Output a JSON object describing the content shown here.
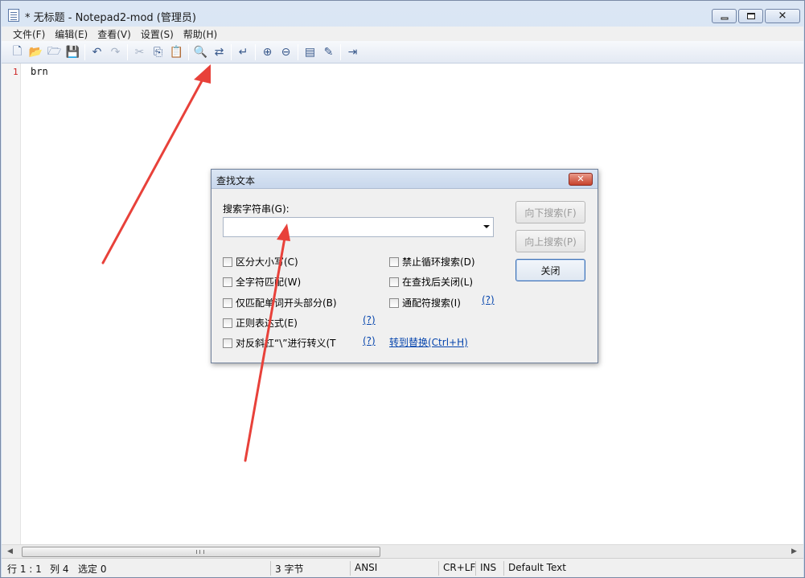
{
  "window": {
    "title": "* 无标题 - Notepad2-mod (管理员)",
    "controls": {
      "minimize": "minimize-icon",
      "maximize": "maximize-icon",
      "close": "close-icon"
    }
  },
  "menu": [
    "文件(F)",
    "编辑(E)",
    "查看(V)",
    "设置(S)",
    "帮助(H)"
  ],
  "toolbar": [
    {
      "icon": "new-file-icon",
      "glyph": "🗋"
    },
    {
      "icon": "open-folder-icon",
      "glyph": "📂"
    },
    {
      "icon": "browse-icon",
      "glyph": "🗁"
    },
    {
      "icon": "save-icon",
      "glyph": "💾"
    },
    {
      "sep": true
    },
    {
      "icon": "undo-icon",
      "glyph": "↶"
    },
    {
      "icon": "redo-icon",
      "glyph": "↷",
      "dim": true
    },
    {
      "sep": true
    },
    {
      "icon": "cut-icon",
      "glyph": "✂",
      "dim": true
    },
    {
      "icon": "copy-icon",
      "glyph": "⎘"
    },
    {
      "icon": "paste-icon",
      "glyph": "📋"
    },
    {
      "sep": true
    },
    {
      "icon": "find-icon",
      "glyph": "🔍"
    },
    {
      "icon": "replace-icon",
      "glyph": "⇄"
    },
    {
      "sep": true
    },
    {
      "icon": "word-wrap-icon",
      "glyph": "↵"
    },
    {
      "sep": true
    },
    {
      "icon": "zoom-in-icon",
      "glyph": "⊕"
    },
    {
      "icon": "zoom-out-icon",
      "glyph": "⊖"
    },
    {
      "sep": true
    },
    {
      "icon": "scheme-icon",
      "glyph": "▤"
    },
    {
      "icon": "customize-icon",
      "glyph": "✎"
    },
    {
      "sep": true
    },
    {
      "icon": "exit-icon",
      "glyph": "⇥"
    }
  ],
  "editor": {
    "line_number": "1",
    "line_text": "brn"
  },
  "statusbar": {
    "position": "行 1 : 1",
    "column": "列 4",
    "selection": "选定 0",
    "size": "3 字节",
    "encoding": "ANSI",
    "eol": "CR+LF",
    "mode": "INS",
    "scheme": "Default Text"
  },
  "dialog": {
    "title": "查找文本",
    "close_glyph": "✕",
    "search_label": "搜索字符串(G):",
    "search_value": "",
    "options": {
      "match_case": "区分大小写(C)",
      "whole_word": "全字符匹配(W)",
      "word_start": "仅匹配单词开头部分(B)",
      "regex": "正则表达式(E)",
      "backslash": "对反斜杠“\\”进行转义(T",
      "no_wrap": "禁止循环搜索(D)",
      "close_after": "在查找后关闭(L)",
      "wildcard": "通配符搜索(I)"
    },
    "help": "(?)",
    "goto_replace": "转到替换(Ctrl+H)",
    "buttons": {
      "find_next": "向下搜索(F)",
      "find_prev": "向上搜索(P)",
      "close": "关闭"
    }
  },
  "colors": {
    "arrow": "#e8413a",
    "titlebar": "#dbe6f4",
    "link": "#0645ad"
  }
}
